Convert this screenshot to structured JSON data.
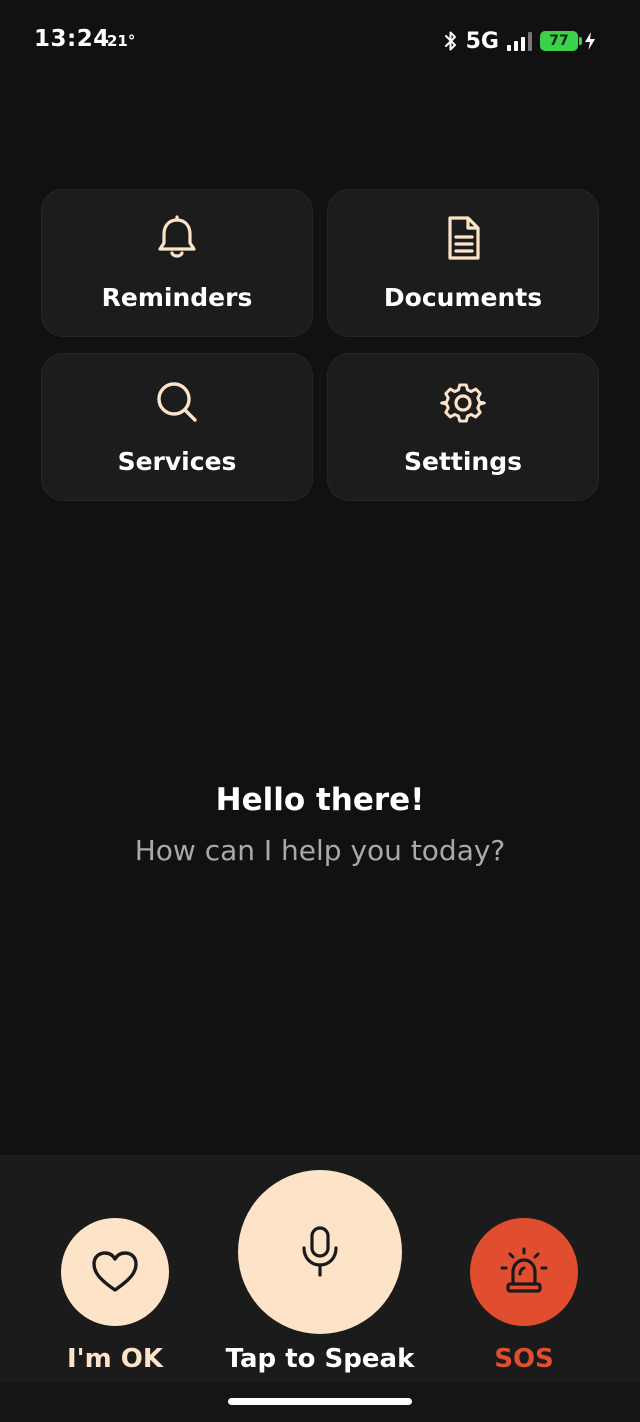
{
  "status_bar": {
    "time": "13:24",
    "temperature": "21°",
    "network": "5G",
    "battery_level": "77",
    "battery_color": "#3bd14b"
  },
  "tiles": [
    {
      "label": "Reminders",
      "icon": "bell-icon"
    },
    {
      "label": "Documents",
      "icon": "document-icon"
    },
    {
      "label": "Services",
      "icon": "search-icon"
    },
    {
      "label": "Settings",
      "icon": "gear-icon"
    }
  ],
  "greeting": {
    "title": "Hello there!",
    "subtitle": "How can I help you today?"
  },
  "dock": {
    "ok_label": "I'm OK",
    "speak_label": "Tap to Speak",
    "sos_label": "SOS",
    "ok_icon": "heart-icon",
    "speak_icon": "microphone-icon",
    "sos_icon": "siren-icon"
  },
  "colors": {
    "background": "#111111",
    "tile_background": "#1c1c1c",
    "accent_peach": "#fde4c8",
    "sos_red": "#e04e2f",
    "subtitle_gray": "#a9a9a9"
  }
}
